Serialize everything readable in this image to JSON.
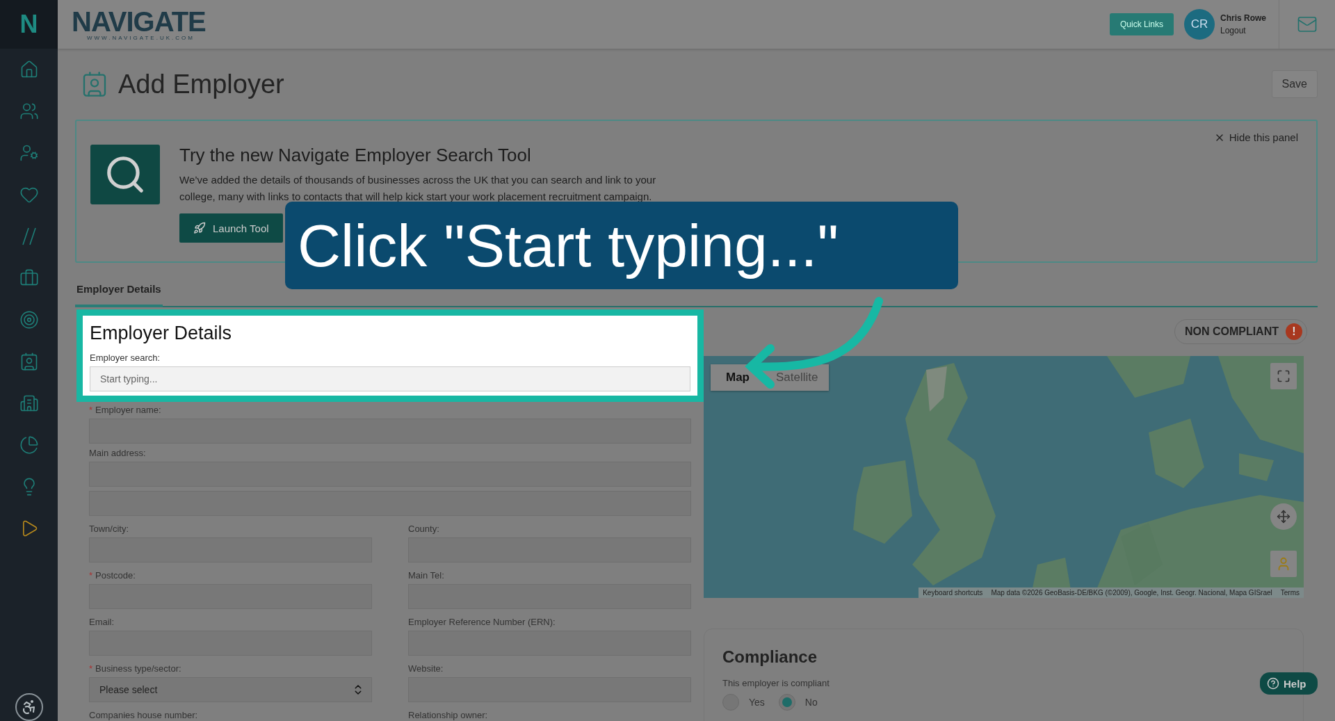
{
  "brand": {
    "mark": "N",
    "logo": "NAVIGATE",
    "logo_sub": "WWW.NAVIGATE.UK.COM"
  },
  "header": {
    "quick_links": "Quick Links",
    "user": {
      "initials": "CR",
      "name": "Chris Rowe",
      "logout": "Logout"
    }
  },
  "page": {
    "title": "Add Employer",
    "save": "Save"
  },
  "banner": {
    "close": "Hide this panel",
    "title": "Try the new Navigate Employer Search Tool",
    "text": "We’ve added the details of thousands of businesses across the UK that you can search and link to your college, many with links to contacts that will help kick start your work placement recruitment campaign.",
    "button": "Launch Tool"
  },
  "tabs": [
    {
      "label": "Employer Details",
      "selected": true
    }
  ],
  "callout": {
    "text": "Click \"Start typing...\""
  },
  "form": {
    "title": "Employer Details",
    "required_mark": "*",
    "search": {
      "label": "Employer search:",
      "placeholder": "Start typing..."
    },
    "fields": [
      {
        "kind": "full",
        "label": "Employer name:",
        "required": true
      },
      {
        "kind": "full",
        "label": "Main address:",
        "required": false
      },
      {
        "kind": "line"
      },
      {
        "kind": "half",
        "label": "Town/city:",
        "required": false
      },
      {
        "kind": "half",
        "label": "County:",
        "required": false
      },
      {
        "kind": "half",
        "label": "Postcode:",
        "required": true
      },
      {
        "kind": "half",
        "label": "Main Tel:",
        "required": false
      },
      {
        "kind": "half",
        "label": "Email:",
        "required": false
      },
      {
        "kind": "half",
        "label": "Employer Reference Number (ERN):",
        "required": false
      },
      {
        "kind": "select",
        "label": "Business type/sector:",
        "required": true,
        "value": "Please select"
      },
      {
        "kind": "half",
        "label": "Website:",
        "required": false
      },
      {
        "kind": "cut",
        "label": "Companies house number:"
      },
      {
        "kind": "cut",
        "label": "Relationship owner:"
      }
    ]
  },
  "status": {
    "label": "NON COMPLIANT",
    "mark": "!"
  },
  "map": {
    "types": [
      {
        "label": "Map",
        "selected": true
      },
      {
        "label": "Satellite",
        "selected": false
      }
    ],
    "footer": [
      "Keyboard shortcuts",
      "Map data ©2026 GeoBasis-DE/BKG (©2009), Google, Inst. Geogr. Nacional, Mapa GISrael",
      "Terms"
    ]
  },
  "compliance": {
    "title": "Compliance",
    "question": "This employer is compliant",
    "options": [
      {
        "label": "Yes",
        "selected": false
      },
      {
        "label": "No",
        "selected": true
      }
    ]
  },
  "help": "Help"
}
